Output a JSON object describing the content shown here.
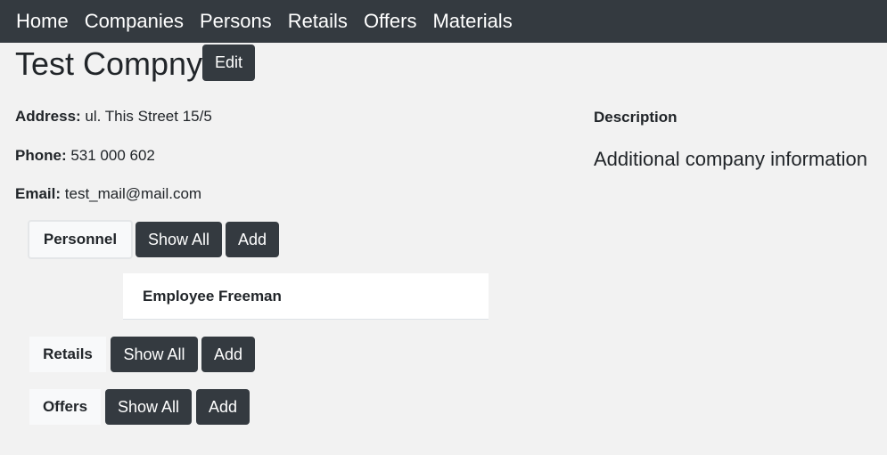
{
  "nav": {
    "items": [
      "Home",
      "Companies",
      "Persons",
      "Retails",
      "Offers",
      "Materials"
    ]
  },
  "company": {
    "name": "Test Compny",
    "edit_label": "Edit",
    "address_label": "Address:",
    "address": "ul. This Street 15/5",
    "phone_label": "Phone:",
    "phone": "531 000 602",
    "email_label": "Email:",
    "email": "test_mail@mail.com"
  },
  "description": {
    "heading": "Description",
    "text": "Additional company information"
  },
  "sections": {
    "personnel": {
      "label": "Personnel",
      "show_all_label": "Show All",
      "add_label": "Add",
      "items": [
        "Employee Freeman"
      ]
    },
    "retails": {
      "label": "Retails",
      "show_all_label": "Show All",
      "add_label": "Add"
    },
    "offers": {
      "label": "Offers",
      "show_all_label": "Show All",
      "add_label": "Add"
    }
  },
  "colors": {
    "navbar": "#343a40",
    "button": "#343a40",
    "background": "#f2f2f2"
  }
}
